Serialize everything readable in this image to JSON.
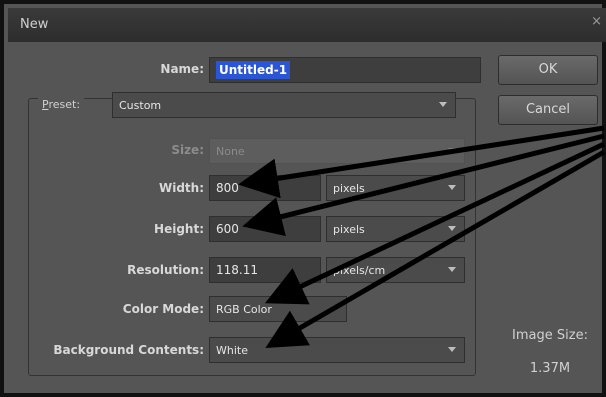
{
  "window": {
    "title": "New",
    "close_glyph": "×"
  },
  "name": {
    "label": "Name:",
    "value": "Untitled-1"
  },
  "preset": {
    "label_first": "P",
    "label_rest": "reset:",
    "value": "Custom"
  },
  "size": {
    "label": "Size:",
    "value": "None"
  },
  "width": {
    "label": "Width:",
    "value": "800",
    "unit": "pixels"
  },
  "height": {
    "label": "Height:",
    "value": "600",
    "unit": "pixels"
  },
  "resolution": {
    "label": "Resolution:",
    "value": "118.11",
    "unit": "pixels/cm"
  },
  "color_mode": {
    "label": "Color Mode:",
    "value": "RGB Color"
  },
  "background_contents": {
    "label": "Background Contents:",
    "value": "White"
  },
  "buttons": {
    "ok": "OK",
    "cancel": "Cancel"
  },
  "image_size": {
    "label": "Image Size:",
    "value": "1.37M"
  },
  "annotation": {
    "arrow_color": "#000000",
    "arrow_icon": "arrow-icon"
  }
}
